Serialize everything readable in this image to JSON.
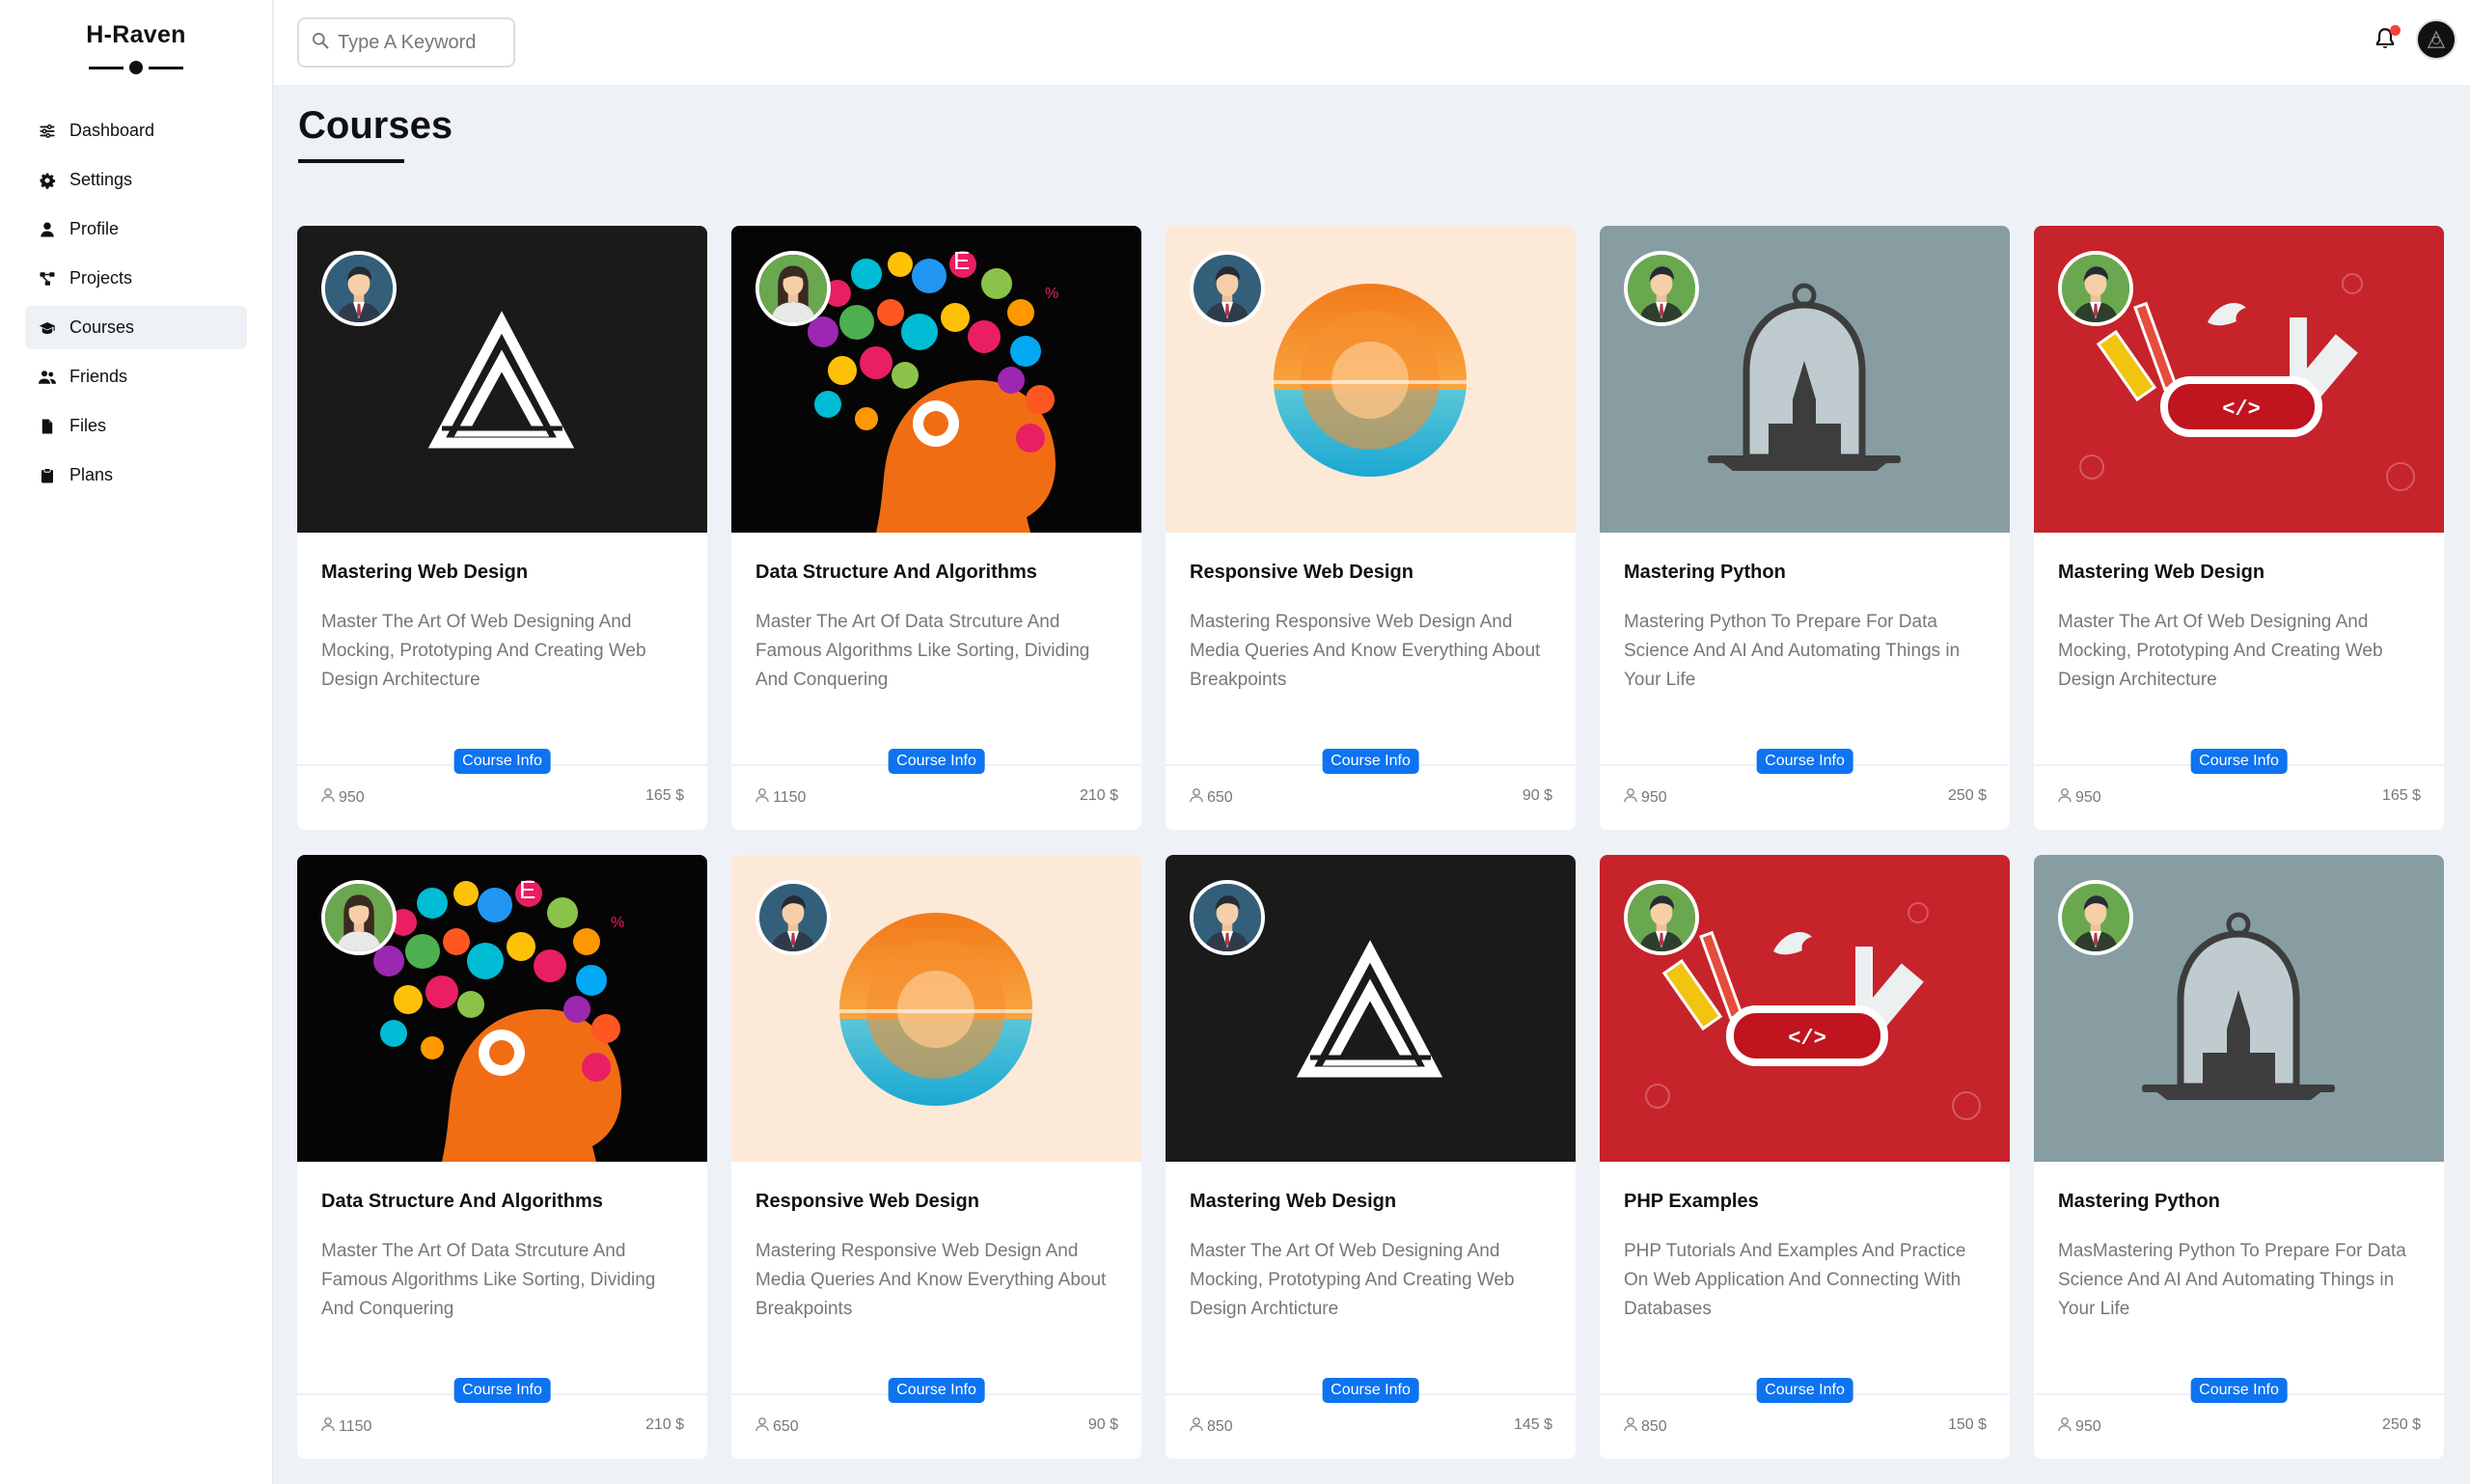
{
  "brand": {
    "title": "H-Raven"
  },
  "sidebar": {
    "items": [
      {
        "label": "Dashboard",
        "icon": "sliders-icon"
      },
      {
        "label": "Settings",
        "icon": "gear-icon"
      },
      {
        "label": "Profile",
        "icon": "user-icon"
      },
      {
        "label": "Projects",
        "icon": "project-diagram-icon"
      },
      {
        "label": "Courses",
        "icon": "graduation-cap-icon",
        "active": true
      },
      {
        "label": "Friends",
        "icon": "users-icon"
      },
      {
        "label": "Files",
        "icon": "file-icon"
      },
      {
        "label": "Plans",
        "icon": "clipboard-icon"
      }
    ]
  },
  "header": {
    "search_placeholder": "Type A Keyword",
    "notification_badge_color": "#f44336"
  },
  "page": {
    "title": "Courses"
  },
  "colors": {
    "accent": "#0d73f0",
    "background": "#eef2f7"
  },
  "courses": [
    {
      "title": "Mastering Web Design",
      "description": "Master The Art Of Web Designing And Mocking, Prototyping And Creating Web Design Architecture",
      "button": "Course Info",
      "students": "950",
      "price": "165 $",
      "image": "logo-a-dark",
      "author": "man-blue"
    },
    {
      "title": "Data Structure And Algorithms",
      "description": "Master The Art Of Data Strcuture And Famous Algorithms Like Sorting, Dividing And Conquering",
      "button": "Course Info",
      "students": "1150",
      "price": "210 $",
      "image": "head-icons",
      "author": "woman-green"
    },
    {
      "title": "Responsive Web Design",
      "description": "Mastering Responsive Web Design And Media Queries And Know Everything About Breakpoints",
      "button": "Course Info",
      "students": "650",
      "price": "90 $",
      "image": "sunset-circle",
      "author": "man-blue"
    },
    {
      "title": "Mastering Python",
      "description": "Mastering Python To Prepare For Data Science And AI And Automating Things in Your Life",
      "button": "Course Info",
      "students": "950",
      "price": "250 $",
      "image": "bell-jar",
      "author": "man-green"
    },
    {
      "title": "Mastering Web Design",
      "description": "Master The Art Of Web Designing And Mocking, Prototyping And Creating Web Design Architecture",
      "button": "Course Info",
      "students": "950",
      "price": "165 $",
      "image": "swiss-knife",
      "author": "man-green"
    },
    {
      "title": "Data Structure And Algorithms",
      "description": "Master The Art Of Data Strcuture And Famous Algorithms Like Sorting, Dividing And Conquering",
      "button": "Course Info",
      "students": "1150",
      "price": "210 $",
      "image": "head-icons",
      "author": "woman-green"
    },
    {
      "title": "Responsive Web Design",
      "description": "Mastering Responsive Web Design And Media Queries And Know Everything About Breakpoints",
      "button": "Course Info",
      "students": "650",
      "price": "90 $",
      "image": "sunset-circle",
      "author": "man-blue"
    },
    {
      "title": "Mastering Web Design",
      "description": "Master The Art Of Web Designing And Mocking, Prototyping And Creating Web Design Archticture",
      "button": "Course Info",
      "students": "850",
      "price": "145 $",
      "image": "logo-a-dark",
      "author": "man-blue"
    },
    {
      "title": "PHP Examples",
      "description": "PHP Tutorials And Examples And Practice On Web Application And Connecting With Databases",
      "button": "Course Info",
      "students": "850",
      "price": "150 $",
      "image": "swiss-knife",
      "author": "man-green"
    },
    {
      "title": "Mastering Python",
      "description": "MasMastering Python To Prepare For Data Science And AI And Automating Things in Your Life",
      "button": "Course Info",
      "students": "950",
      "price": "250 $",
      "image": "bell-jar",
      "author": "man-green"
    }
  ]
}
